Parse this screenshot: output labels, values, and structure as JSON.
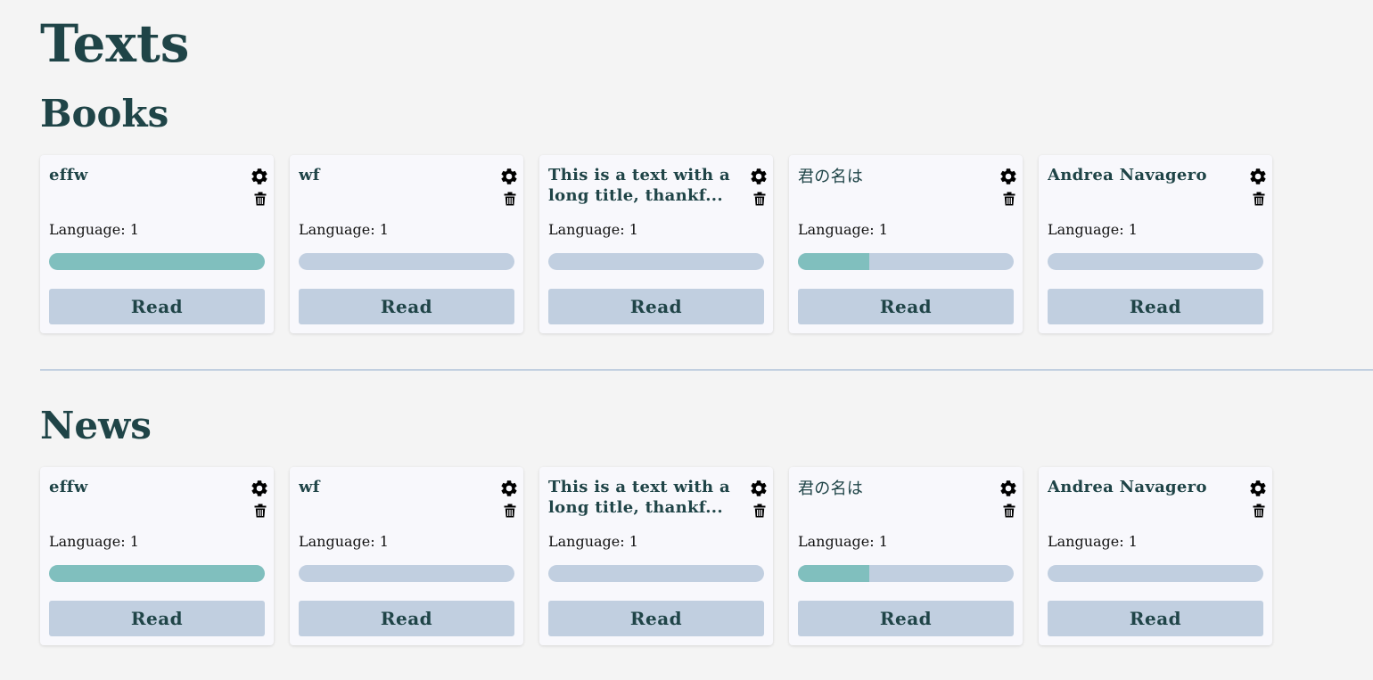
{
  "page": {
    "title": "Texts"
  },
  "sections": [
    {
      "title": "Books",
      "cards": [
        {
          "title": "effw",
          "language": "Language: 1",
          "progress": 1.0,
          "read_label": "Read"
        },
        {
          "title": "wf",
          "language": "Language: 1",
          "progress": 0.0,
          "read_label": "Read"
        },
        {
          "title": "This is a text with a long title, thankf...",
          "language": "Language: 1",
          "progress": 0.0,
          "read_label": "Read"
        },
        {
          "title": "君の名は",
          "language": "Language: 1",
          "progress": 0.33,
          "read_label": "Read"
        },
        {
          "title": "Andrea Navagero",
          "language": "Language: 1",
          "progress": 0.0,
          "read_label": "Read"
        }
      ]
    },
    {
      "title": "News",
      "cards": [
        {
          "title": "effw",
          "language": "Language: 1",
          "progress": 1.0,
          "read_label": "Read"
        },
        {
          "title": "wf",
          "language": "Language: 1",
          "progress": 0.0,
          "read_label": "Read"
        },
        {
          "title": "This is a text with a long title, thankf...",
          "language": "Language: 1",
          "progress": 0.0,
          "read_label": "Read"
        },
        {
          "title": "君の名は",
          "language": "Language: 1",
          "progress": 0.33,
          "read_label": "Read"
        },
        {
          "title": "Andrea Navagero",
          "language": "Language: 1",
          "progress": 0.0,
          "read_label": "Read"
        }
      ]
    }
  ],
  "icons": {
    "settings": "gear-icon",
    "delete": "trash-icon"
  },
  "colors": {
    "text": "#1f4447",
    "progress_track": "#c1cfe0",
    "progress_fill": "#80bfbe",
    "button_bg": "#c1cfe0",
    "card_bg": "#f8f8fc",
    "page_bg": "#f4f4f4"
  }
}
